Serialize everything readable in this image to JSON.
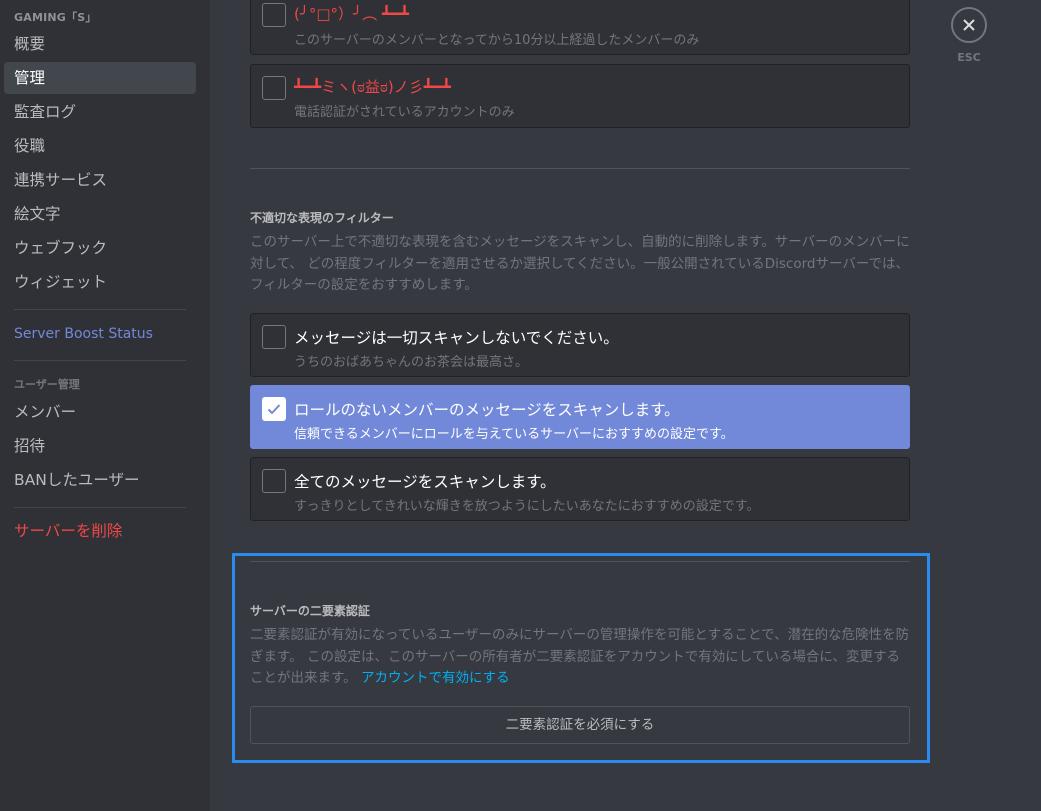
{
  "sidebar": {
    "server_name": "GAMING「S」",
    "items": [
      {
        "label": "概要"
      },
      {
        "label": "管理",
        "active": true
      },
      {
        "label": "監査ログ"
      },
      {
        "label": "役職"
      },
      {
        "label": "連携サービス"
      },
      {
        "label": "絵文字"
      },
      {
        "label": "ウェブフック"
      },
      {
        "label": "ウィジェット"
      }
    ],
    "boost_label": "Server Boost Status",
    "user_mgmt_header": "ユーザー管理",
    "user_items": [
      {
        "label": "メンバー"
      },
      {
        "label": "招待"
      },
      {
        "label": "BANしたユーザー"
      }
    ],
    "delete_label": "サーバーを削除"
  },
  "verification": {
    "options": [
      {
        "title": "(╯°□°）╯︵ ┻━┻",
        "desc": "このサーバーのメンバーとなってから10分以上経過したメンバーのみ",
        "checked": false
      },
      {
        "title": "┻━┻ミヽ(ಠ益ಠ)ノ彡┻━┻",
        "desc": "電話認証がされているアカウントのみ",
        "checked": false
      }
    ]
  },
  "content_filter": {
    "title": "不適切な表現のフィルター",
    "description": "このサーバー上で不適切な表現を含むメッセージをスキャンし、自動的に削除します。サーバーのメンバーに対して、 どの程度フィルターを適用させるか選択してください。一般公開されているDiscordサーバーでは、フィルターの設定をおすすめします。",
    "options": [
      {
        "title": "メッセージは一切スキャンしないでください。",
        "desc": "うちのおばあちゃんのお茶会は最高さ。",
        "checked": false
      },
      {
        "title": "ロールのないメンバーのメッセージをスキャンします。",
        "desc": "信頼できるメンバーにロールを与えているサーバーにおすすめの設定です。",
        "checked": true
      },
      {
        "title": "全てのメッセージをスキャンします。",
        "desc": "すっきりとしてきれいな輝きを放つようにしたいあなたにおすすめの設定です。",
        "checked": false
      }
    ]
  },
  "two_factor": {
    "title": "サーバーの二要素認証",
    "description": "二要素認証が有効になっているユーザーのみにサーバーの管理操作を可能とすることで、潜在的な危険性を防ぎます。 この設定は、このサーバーの所有者が二要素認証をアカウントで有効にしている場合に、変更することが出来ます。",
    "link_label": "アカウントで有効にする",
    "button_label": "二要素認証を必須にする"
  },
  "tools": {
    "close_label": "ESC"
  },
  "colors": {
    "accent": "#7289da",
    "danger": "#f04747",
    "link": "#00b0f4",
    "highlight": "#2b8cf0"
  }
}
